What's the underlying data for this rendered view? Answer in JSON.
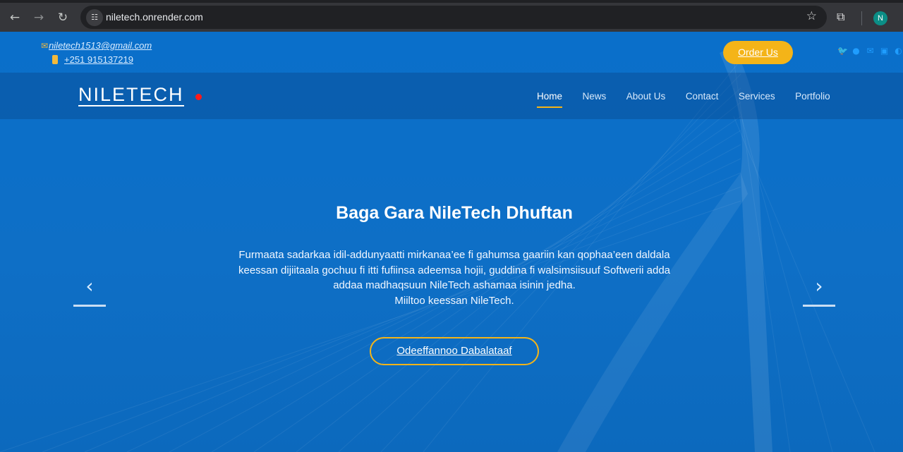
{
  "browser": {
    "url": "niletech.onrender.com",
    "profile_initial": "N",
    "back_icon": "←",
    "forward_icon": "→",
    "reload_icon": "↻",
    "star_icon": "☆",
    "extensions_icon": "⧉",
    "site_info_icon": "☷"
  },
  "topbar": {
    "email": "niletech1513@gmail.com",
    "phone": "+251 915137219",
    "order_label": "Order Us",
    "social_icons": [
      "twitter-icon",
      "facebook-icon",
      "email-icon",
      "linkedin-icon",
      "other-icon"
    ]
  },
  "nav": {
    "brand": "NILETECH",
    "items": [
      "Home",
      "News",
      "About Us",
      "Contact",
      "Services",
      "Portfolio"
    ],
    "active": "Home"
  },
  "hero": {
    "title": "Baga Gara NileTech Dhuftan",
    "line1": "Furmaata sadarkaa idil-addunyaatti mirkanaa’ee fi gahumsa gaariin kan qophaa’een daldala",
    "line2": "keessan dijiitaala gochuu fi itti fufiinsa adeemsa hojii, guddina fi walsimsiisuuf Softwerii adda",
    "line3": "addaa madhaqsuun NileTech ashamaa isinin jedha.",
    "line4": "Miiltoo keessan NileTech.",
    "cta_label": "Odeeffannoo Dabalataaf"
  },
  "colors": {
    "accent": "#f4b418",
    "background": "#0d6ec4",
    "brand_dot": "#ff1a1a"
  }
}
